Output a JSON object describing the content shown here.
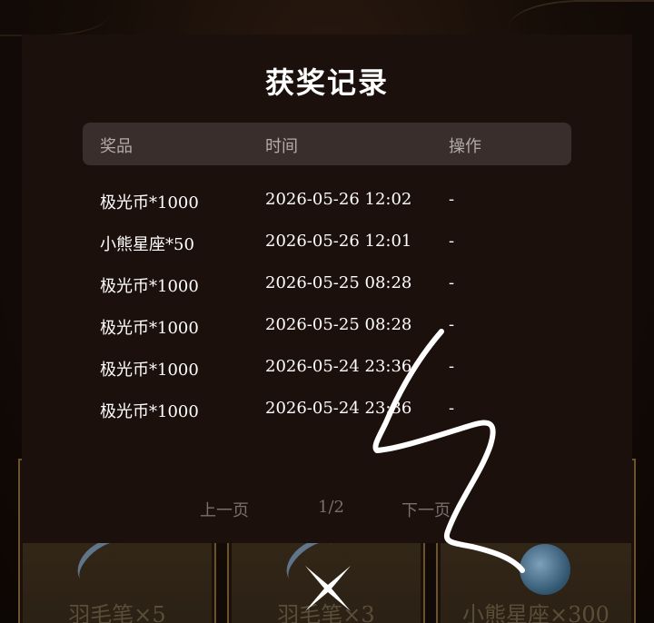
{
  "modal": {
    "title": "获奖记录",
    "headers": {
      "prize": "奖品",
      "time": "时间",
      "action": "操作"
    },
    "rows": [
      {
        "prize": "极光币*1000",
        "time": "2026-05-26 12:02",
        "action": "-"
      },
      {
        "prize": "小熊星座*50",
        "time": "2026-05-26 12:01",
        "action": "-"
      },
      {
        "prize": "极光币*1000",
        "time": "2026-05-25 08:28",
        "action": "-"
      },
      {
        "prize": "极光币*1000",
        "time": "2026-05-25 08:28",
        "action": "-"
      },
      {
        "prize": "极光币*1000",
        "time": "2026-05-24 23:36",
        "action": "-"
      },
      {
        "prize": "极光币*1000",
        "time": "2026-05-24 23:36",
        "action": "-"
      }
    ],
    "pager": {
      "prev": "上一页",
      "page": "1/2",
      "next": "下一页"
    }
  },
  "cards": [
    {
      "label": "羽毛笔×5",
      "icon": "quill-icon"
    },
    {
      "label": "羽毛笔×3",
      "icon": "quill-icon"
    },
    {
      "label": "小熊星座×300",
      "icon": "coin-icon"
    }
  ],
  "close": {
    "icon": "close-icon"
  },
  "colors": {
    "modal_bg": "#1c100c",
    "header_bg": "#3a2e2c",
    "text": "#ffffff",
    "muted": "#7a6f6a"
  }
}
